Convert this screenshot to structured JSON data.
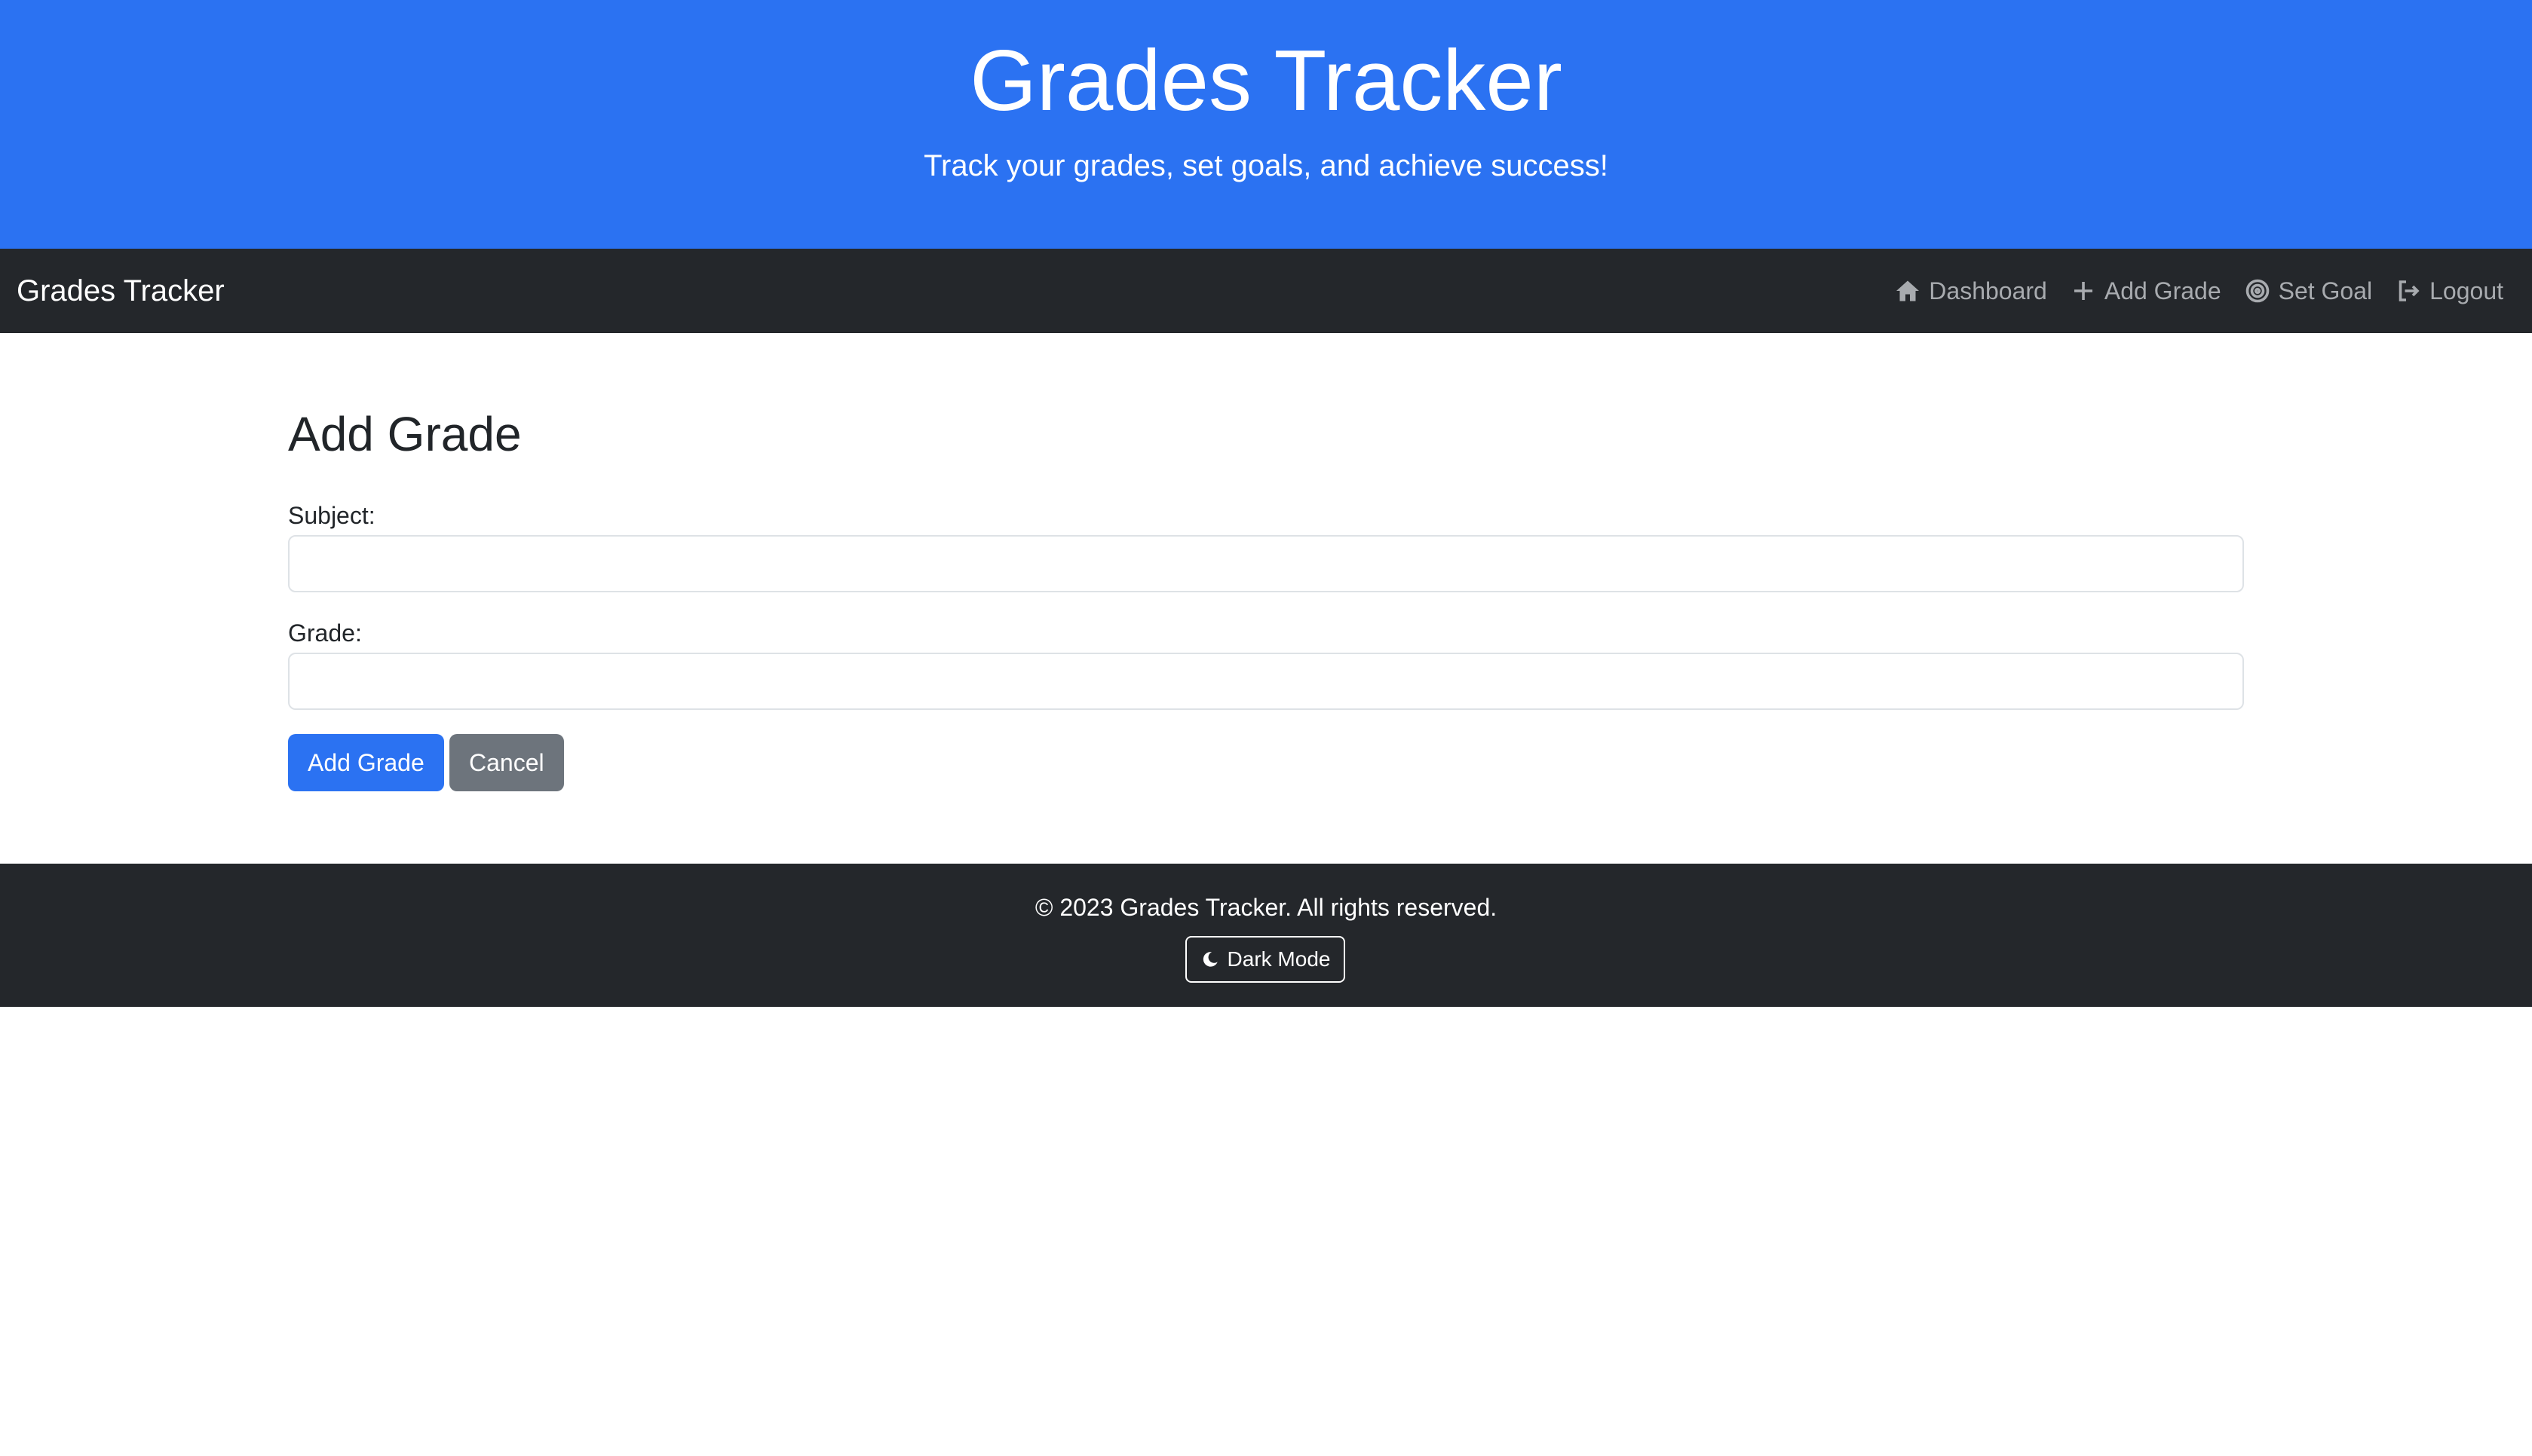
{
  "hero": {
    "title": "Grades Tracker",
    "subtitle": "Track your grades, set goals, and achieve success!"
  },
  "navbar": {
    "brand": "Grades Tracker",
    "links": [
      {
        "label": "Dashboard",
        "icon": "home-icon"
      },
      {
        "label": "Add Grade",
        "icon": "plus-icon"
      },
      {
        "label": "Set Goal",
        "icon": "target-icon"
      },
      {
        "label": "Logout",
        "icon": "logout-icon"
      }
    ]
  },
  "form": {
    "title": "Add Grade",
    "subject_label": "Subject:",
    "subject_value": "",
    "grade_label": "Grade:",
    "grade_value": "",
    "submit_label": "Add Grade",
    "cancel_label": "Cancel"
  },
  "footer": {
    "text": "© 2023 Grades Tracker. All rights reserved.",
    "dark_mode_label": "Dark Mode",
    "dark_mode_icon": "moon-icon"
  },
  "colors": {
    "primary": "#2b72f2",
    "dark": "#24272b",
    "secondary": "#6d747c",
    "nav_link": "#a8abaf"
  }
}
